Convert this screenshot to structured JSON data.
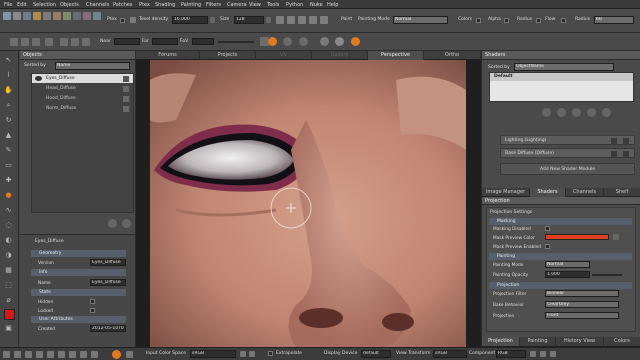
{
  "menu": [
    "File",
    "Edit",
    "Selection",
    "Objects",
    "Channels",
    "Patches",
    "Ptex",
    "Shading",
    "Painting",
    "Filters",
    "Camera",
    "View",
    "Tools",
    "Python",
    "Nuke",
    "Help"
  ],
  "toolbar1": {
    "ptex_label": "Ptex",
    "texel_density_label": "Texel density",
    "texel_density_value": "16.000",
    "size_label": "Size",
    "size_value": "128",
    "paint_label": "Paint",
    "painting_mode_label": "Painting Mode",
    "painting_mode_value": "Normal",
    "colors_label": "Colors",
    "alpha_label": "Alpha",
    "radius_label": "Radius",
    "flow_label": "Flow",
    "radius2_label": "Radius",
    "radius2_value": "60"
  },
  "toolbar2": {
    "near_label": "Near",
    "far_label": "Far",
    "fov_label": "FoV"
  },
  "objects_panel": {
    "title": "Objects",
    "sorted_by_label": "Sorted by",
    "sorted_by_value": "Name",
    "items": [
      "Eyes_Diffuse",
      "Head_Diffuse",
      "Hood_Diffuse",
      "Norm_Diffuse"
    ]
  },
  "properties_panel": {
    "object_name": "Eyes_Diffuse",
    "geometry_header": "Geometry",
    "version_label": "Version",
    "version_value": "Eyes_Diffuse",
    "info_header": "Info",
    "name_label": "Name",
    "name_value": "Eyes_Diffuse",
    "state_header": "State",
    "hidden_label": "Hidden",
    "locked_label": "Locked",
    "user_attr_header": "User Attributes",
    "created_label": "Created",
    "created_value": "2012-05-10T0"
  },
  "viewport_tabs": [
    "Forums",
    "Projects",
    "UV",
    "Gallery",
    "Perspective",
    "Ortho"
  ],
  "shaders_panel": {
    "title": "Shaders",
    "sorted_by_label": "Sorted by",
    "sorted_by_value": "ObjectName",
    "default_item": "Default",
    "layers": [
      "Lighting (Lighting)",
      "Base Diffuse (Diffuse)"
    ],
    "add_button": "Add New Shader Module"
  },
  "mid_tabs": [
    "Image Manager",
    "Shaders",
    "Channels",
    "Shelf"
  ],
  "projection_panel": {
    "title": "Projection",
    "settings_header": "Projection Settings",
    "masking_header": "Masking",
    "masking_disabled_label": "Masking Disabled",
    "mask_preview_color_label": "Mask Preview Color",
    "mask_preview_color": "#e0401e",
    "mask_preview_enabled_label": "Mask Preview Enabled",
    "painting_header": "Painting",
    "painting_mode_label": "Painting Mode",
    "painting_mode_value": "Normal",
    "painting_opacity_label": "Painting Opacity",
    "painting_opacity_value": "1.000",
    "projection_header": "Projection",
    "projection_filter_label": "Projection Filter",
    "projection_filter_value": "Bilinear",
    "bake_behavior_label": "Bake Behavior",
    "bake_behavior_value": "ClearOnly",
    "projection_label": "Projection",
    "projection_value": "Front"
  },
  "bottom_right_tabs": [
    "Projection",
    "Painting",
    "History View",
    "Colors"
  ],
  "statusbar": {
    "input_color_space_label": "Input Color Space",
    "input_color_space_value": "sRGB",
    "extrapolate_label": "Extrapolate",
    "display_device_label": "Display Device",
    "display_device_value": "default",
    "view_transform_label": "View Transform",
    "view_transform_value": "sRGB",
    "component_label": "Component",
    "component_value": "RGB"
  },
  "colors": {
    "accent_orange": "#e07a1e",
    "panel_bg": "#4a4a4a",
    "mask_red": "#e0401e"
  }
}
